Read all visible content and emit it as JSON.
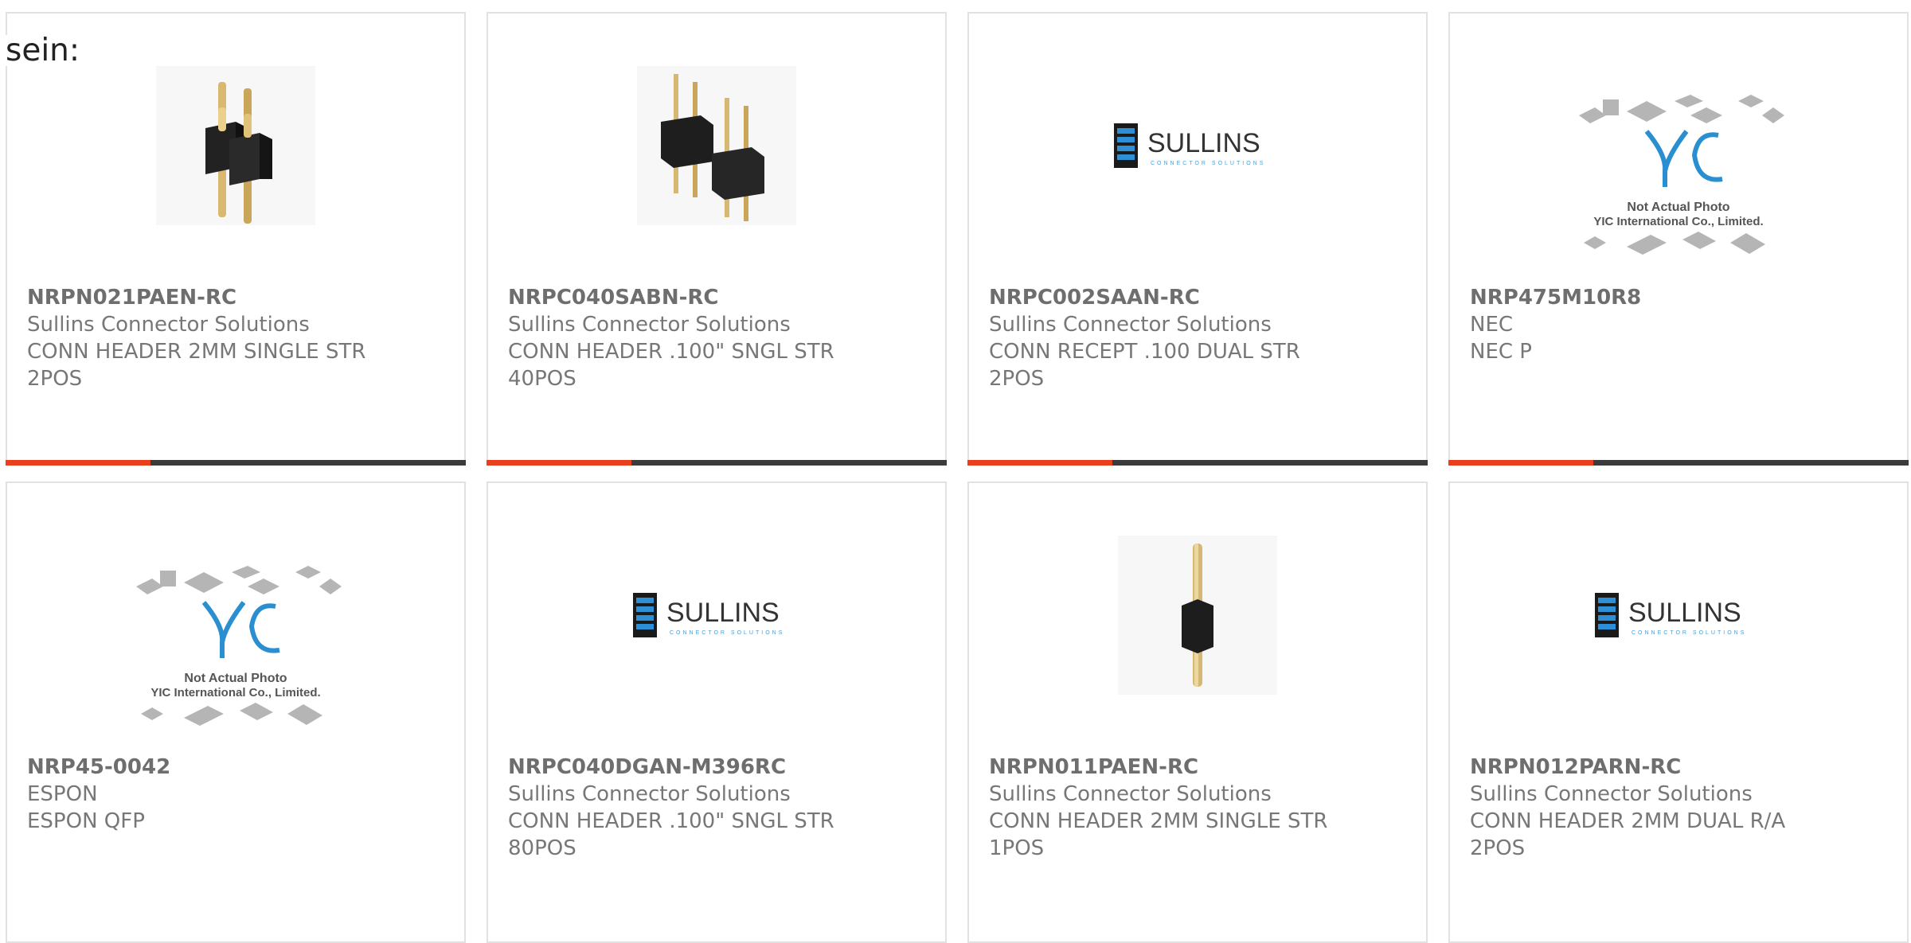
{
  "intro_text": "sein:",
  "colors": {
    "accent": "#e8401c",
    "bar": "#3b3b3b",
    "text": "#777777",
    "border": "#e2e2e2",
    "sullins_blue": "#1e5f9e",
    "yic_blue": "#2a8fd0"
  },
  "products": [
    {
      "part_number": "NRPN021PAEN-RC",
      "manufacturer": "Sullins Connector Solutions",
      "description_line1": "CONN HEADER 2MM SINGLE STR",
      "description_line2": "2POS",
      "image": "pin-header-2-icon"
    },
    {
      "part_number": "NRPC040SABN-RC",
      "manufacturer": "Sullins Connector Solutions",
      "description_line1": "CONN HEADER .100\" SNGL STR",
      "description_line2": "40POS",
      "image": "pin-header-multi-icon"
    },
    {
      "part_number": "NRPC002SAAN-RC",
      "manufacturer": "Sullins Connector Solutions",
      "description_line1": "CONN RECEPT .100 DUAL STR",
      "description_line2": "2POS",
      "image": "sullins-logo",
      "logo_text": "SULLINS",
      "logo_tagline": "CONNECTOR SOLUTIONS"
    },
    {
      "part_number": "NRP475M10R8",
      "manufacturer": "NEC",
      "description_line1": "NEC P",
      "description_line2": "",
      "image": "yic-placeholder",
      "placeholder_line1": "Not Actual Photo",
      "placeholder_line2": "YIC International Co., Limited."
    },
    {
      "part_number": "NRP45-0042",
      "manufacturer": "ESPON",
      "description_line1": "ESPON QFP",
      "description_line2": "",
      "image": "yic-placeholder",
      "placeholder_line1": "Not Actual Photo",
      "placeholder_line2": "YIC International Co., Limited."
    },
    {
      "part_number": "NRPC040DGAN-M396RC",
      "manufacturer": "Sullins Connector Solutions",
      "description_line1": "CONN HEADER .100\" SNGL STR",
      "description_line2": "80POS",
      "image": "sullins-logo",
      "logo_text": "SULLINS",
      "logo_tagline": "CONNECTOR SOLUTIONS"
    },
    {
      "part_number": "NRPN011PAEN-RC",
      "manufacturer": "Sullins Connector Solutions",
      "description_line1": "CONN HEADER 2MM SINGLE STR",
      "description_line2": "1POS",
      "image": "pin-header-1-icon"
    },
    {
      "part_number": "NRPN012PARN-RC",
      "manufacturer": "Sullins Connector Solutions",
      "description_line1": "CONN HEADER 2MM DUAL R/A",
      "description_line2": "2POS",
      "image": "sullins-logo",
      "logo_text": "SULLINS",
      "logo_tagline": "CONNECTOR SOLUTIONS"
    }
  ]
}
